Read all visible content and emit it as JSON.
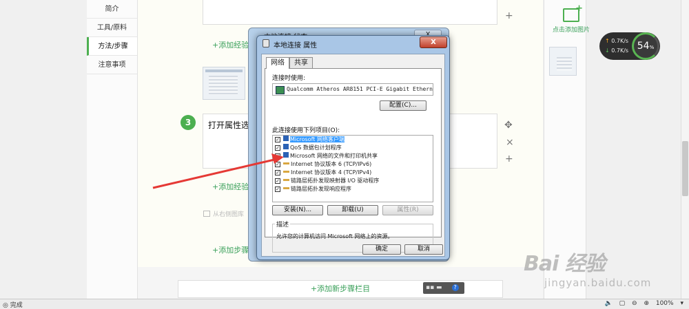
{
  "nav": {
    "items": [
      "简介",
      "工具/原料",
      "方法/步骤",
      "注意事项"
    ],
    "active_index": 2
  },
  "editor": {
    "add_experience": "+添加经验",
    "add_experience_2": "+添加经验",
    "add_step": "+添加步骤方",
    "step_number": "3",
    "step_text": "打开属性选",
    "hint_text": "从右侧图库",
    "add_new_section": "+添加新步骤栏目",
    "controls": {
      "plus": "+",
      "move": "✥",
      "close": "×"
    }
  },
  "right_panel": {
    "add_image_label": "点击添加图片"
  },
  "speed_widget": {
    "upload": "0.7K/s",
    "download": "0.7K/s",
    "percent": "54",
    "percent_sign": "%"
  },
  "background_dialog": {
    "title": "本地连接 状态",
    "close": "X"
  },
  "dialog": {
    "title": "本地连接 属性",
    "close": "X",
    "tabs": [
      "网络",
      "共享"
    ],
    "connect_using_label": "连接时使用:",
    "adapter_name": "Qualcomm Atheros AR8151 PCI-E Gigabit Ethernet",
    "configure_button": "配置(C)...",
    "items_label": "此连接使用下列项目(O):",
    "items": [
      {
        "label": "Microsoft 网络客户端",
        "checked": true,
        "icon": "network-icon",
        "selected": true
      },
      {
        "label": "QoS 数据包计划程序",
        "checked": true,
        "icon": "network-icon",
        "selected": false
      },
      {
        "label": "Microsoft 网络的文件和打印机共享",
        "checked": true,
        "icon": "network-icon",
        "selected": false
      },
      {
        "label": "Internet 协议版本 6 (TCP/IPv6)",
        "checked": true,
        "icon": "protocol-icon",
        "selected": false
      },
      {
        "label": "Internet 协议版本 4 (TCP/IPv4)",
        "checked": true,
        "icon": "protocol-icon",
        "selected": false
      },
      {
        "label": "链路层拓扑发现映射器 I/O 驱动程序",
        "checked": true,
        "icon": "protocol-icon",
        "selected": false
      },
      {
        "label": "链路层拓扑发现响应程序",
        "checked": true,
        "icon": "protocol-icon",
        "selected": false
      }
    ],
    "install_button": "安装(N)...",
    "uninstall_button": "卸载(U)",
    "properties_button": "属性(R)",
    "description_title": "描述",
    "description_text": "允许您的计算机访问 Microsoft 网络上的资源。",
    "ok_button": "确定",
    "cancel_button": "取消"
  },
  "watermark": {
    "logo": "Bai 经验",
    "url": "jingyan.baidu.com"
  },
  "statusbar": {
    "status": "完成",
    "zoom": "100%"
  },
  "colors": {
    "accent": "#4caf50",
    "arrow": "#e53935",
    "selection": "#3399ff"
  }
}
